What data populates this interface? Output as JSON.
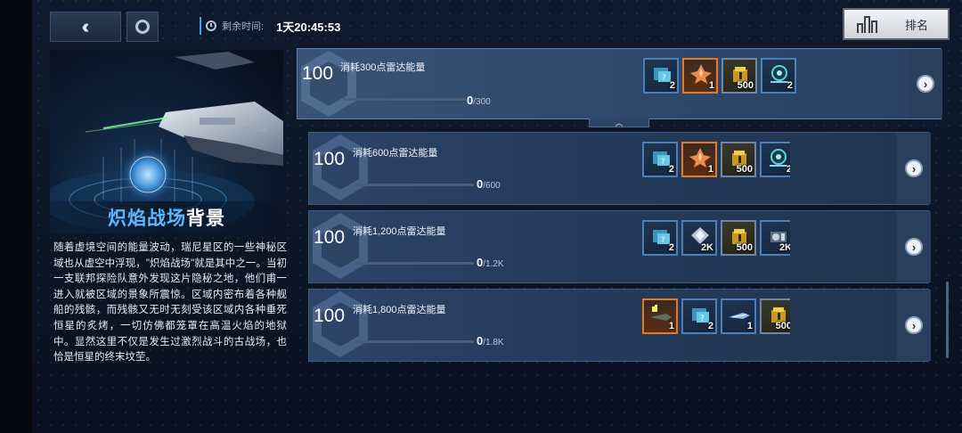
{
  "header": {
    "back_icon": "double-chevron-left-icon",
    "settings_icon": "gear-icon",
    "timer_label": "剩余时间:",
    "timer_value": "1天20:45:53",
    "rank_label": "排名"
  },
  "event": {
    "title_highlight": "炽焰战场",
    "title_rest": "背景",
    "description": "随着虚境空间的能量波动，瑞尼星区的一些神秘区域也从虚空中浮现，\"炽焰战场\"就是其中之一。当初一支联邦探险队意外发现这片隐秘之地，他们甫一进入就被区域的景象所震惊。区域内密布着各种舰船的残骸，而残骸又无时无刻受该区域内各种垂死恒星的炙烤，一切仿佛都笼罩在高温火焰的地狱中。显然这里不仅是发生过激烈战斗的古战场，也恰是恒星的终末坟茔。"
  },
  "tasks": [
    {
      "points": "100",
      "name": "消耗300点雷达能量",
      "progress_current": "0",
      "progress_total": "/300",
      "progress_fraction": 0,
      "rewards": [
        {
          "icon": "blueprint-card-icon",
          "count": "2",
          "style": "blue"
        },
        {
          "icon": "orange-crystal-icon",
          "count": "1",
          "style": "orange"
        },
        {
          "icon": "gold-crate-icon",
          "count": "500",
          "style": "gold"
        },
        {
          "icon": "radar-module-icon",
          "count": "2",
          "style": "blue"
        }
      ]
    },
    {
      "points": "100",
      "name": "消耗600点雷达能量",
      "progress_current": "0",
      "progress_total": "/600",
      "progress_fraction": 0,
      "rewards": [
        {
          "icon": "blueprint-card-icon",
          "count": "2",
          "style": "blue"
        },
        {
          "icon": "orange-crystal-icon",
          "count": "1",
          "style": "orange"
        },
        {
          "icon": "gold-crate-icon",
          "count": "500",
          "style": "gold"
        },
        {
          "icon": "radar-module-icon",
          "count": "2",
          "style": "blue"
        }
      ]
    },
    {
      "points": "100",
      "name": "消耗1,200点雷达能量",
      "progress_current": "0",
      "progress_total": "/1.2K",
      "progress_fraction": 0,
      "rewards": [
        {
          "icon": "blueprint-card-icon",
          "count": "2",
          "style": "blue"
        },
        {
          "icon": "silver-crystal-icon",
          "count": "2K",
          "style": "blue"
        },
        {
          "icon": "gold-crate-icon",
          "count": "500",
          "style": "gold"
        },
        {
          "icon": "engine-part-icon",
          "count": "2K",
          "style": "blue"
        }
      ]
    },
    {
      "points": "100",
      "name": "消耗1,800点雷达能量",
      "progress_current": "0",
      "progress_total": "/1.8K",
      "progress_fraction": 0,
      "rewards": [
        {
          "icon": "ship-blueprint-icon",
          "count": "1",
          "style": "orange"
        },
        {
          "icon": "blueprint-card-icon",
          "count": "2",
          "style": "blue"
        },
        {
          "icon": "warship-icon",
          "count": "1",
          "style": "blue"
        },
        {
          "icon": "gold-crate-icon",
          "count": "500",
          "style": "gold"
        }
      ]
    }
  ],
  "go_icon": "chevron-right-icon",
  "collapse_icon": "chevron-up-icon"
}
